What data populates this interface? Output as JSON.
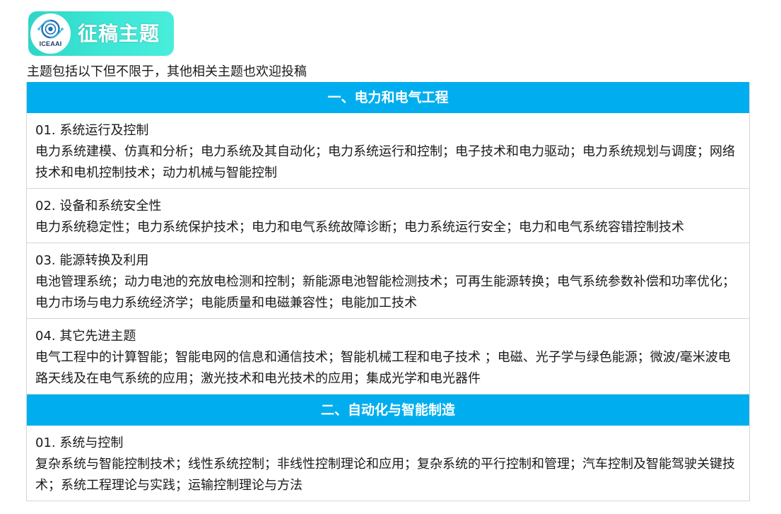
{
  "header": {
    "logo_text": "ICEAAI",
    "title": "征稿主题"
  },
  "intro": "主题包括以下但不限于，其他相关主题也欢迎投稿",
  "sections": [
    {
      "heading": "一、电力和电气工程",
      "items": [
        {
          "title": "01. 系统运行及控制",
          "desc": "电力系统建模、仿真和分析；电力系统及其自动化；电力系统运行和控制；电子技术和电力驱动；电力系统规划与调度；网络技术和电机控制技术；动力机械与智能控制"
        },
        {
          "title": "02. 设备和系统安全性",
          "desc": "电力系统稳定性；电力系统保护技术；电力和电气系统故障诊断；电力系统运行安全；电力和电气系统容错控制技术"
        },
        {
          "title": "03. 能源转换及利用",
          "desc": "电池管理系统；动力电池的充放电检测和控制；新能源电池智能检测技术；可再生能源转换；电气系统参数补偿和功率优化；电力市场与电力系统经济学；电能质量和电磁兼容性；电能加工技术"
        },
        {
          "title": "04. 其它先进主题",
          "desc": "电气工程中的计算智能；智能电网的信息和通信技术；智能机械工程和电子技术 ；电磁、光子学与绿色能源；微波/毫米波电路天线及在电气系统的应用；激光技术和电光技术的应用；集成光学和电光器件"
        }
      ]
    },
    {
      "heading": "二、自动化与智能制造",
      "items": [
        {
          "title": "01. 系统与控制",
          "desc": "复杂系统与智能控制技术；线性系统控制；非线性控制理论和应用；复杂系统的平行控制和管理；汽车控制及智能驾驶关键技术；系统工程理论与实践；运输控制理论与方法"
        }
      ]
    }
  ],
  "colors": {
    "section_header_bg": "#00aeef",
    "badge_gradient_start": "#2fd6c7",
    "badge_gradient_end": "#49edda",
    "border": "#d6d6d6"
  },
  "icons": {
    "logo": "iceaai-logo-icon"
  }
}
